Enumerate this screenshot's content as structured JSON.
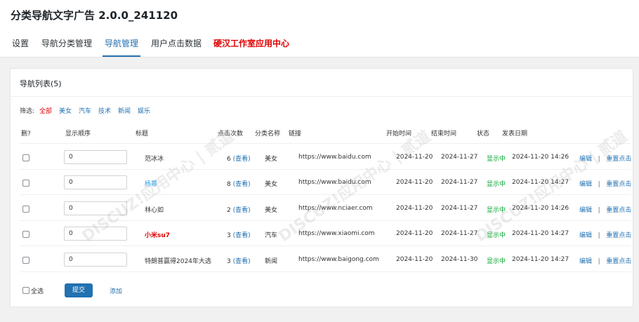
{
  "app": {
    "title": "分类导航文字广告 2.0.0_241120"
  },
  "tabs": [
    {
      "label": "设置"
    },
    {
      "label": "导航分类管理"
    },
    {
      "label": "导航管理"
    },
    {
      "label": "用户点击数据"
    },
    {
      "label": "硬汉工作室应用中心"
    }
  ],
  "card": {
    "title": "导航列表(5)"
  },
  "filter": {
    "label": "筛选:",
    "items": [
      "全部",
      "美女",
      "汽车",
      "技术",
      "新闻",
      "娱乐"
    ]
  },
  "columns": [
    "删?",
    "显示顺序",
    "标题",
    "点击次数",
    "分类名称",
    "链接",
    "开始时间",
    "结束时间",
    "状态",
    "发表日期"
  ],
  "rows": [
    {
      "order": "0",
      "title": "范冰冰",
      "clicks": "6",
      "view": "(查看)",
      "category": "美女",
      "link": "https://www.baidu.com",
      "start": "2024-11-20",
      "end": "2024-11-27",
      "status": "显示中",
      "posted": "2024-11-20 14:26"
    },
    {
      "order": "0",
      "title": "杨幂",
      "clicks": "8",
      "view": "(查看)",
      "category": "美女",
      "link": "https://www.baidu.com",
      "start": "2024-11-20",
      "end": "2024-11-27",
      "status": "显示中",
      "posted": "2024-11-20 14:27"
    },
    {
      "order": "0",
      "title": "林心如",
      "clicks": "2",
      "view": "(查看)",
      "category": "美女",
      "link": "https://www.nciaer.com",
      "start": "2024-11-20",
      "end": "2024-11-27",
      "status": "显示中",
      "posted": "2024-11-20 14:26"
    },
    {
      "order": "0",
      "title": "小米su7",
      "clicks": "3",
      "view": "(查看)",
      "category": "汽车",
      "link": "https://www.xiaomi.com",
      "start": "2024-11-20",
      "end": "2024-11-27",
      "status": "显示中",
      "posted": "2024-11-20 14:27"
    },
    {
      "order": "0",
      "title": "特朗普赢得2024年大选",
      "clicks": "3",
      "view": "(查看)",
      "category": "新闻",
      "link": "https://www.baigong.com",
      "start": "2024-11-20",
      "end": "2024-11-30",
      "status": "显示中",
      "posted": "2024-11-20 14:27"
    }
  ],
  "actions": {
    "edit": "编辑",
    "separator": "|",
    "reset": "重置点击"
  },
  "footer": {
    "select_all": "全选",
    "submit": "提交",
    "add": "添加"
  },
  "watermark": {
    "text": "DISCUZ!应用中心 | 贰道"
  },
  "colors": {
    "accent": "#2271b1",
    "status_green": "#00a32a",
    "highlight_red": "#e00000",
    "title_blue": "#2ea0e6"
  }
}
